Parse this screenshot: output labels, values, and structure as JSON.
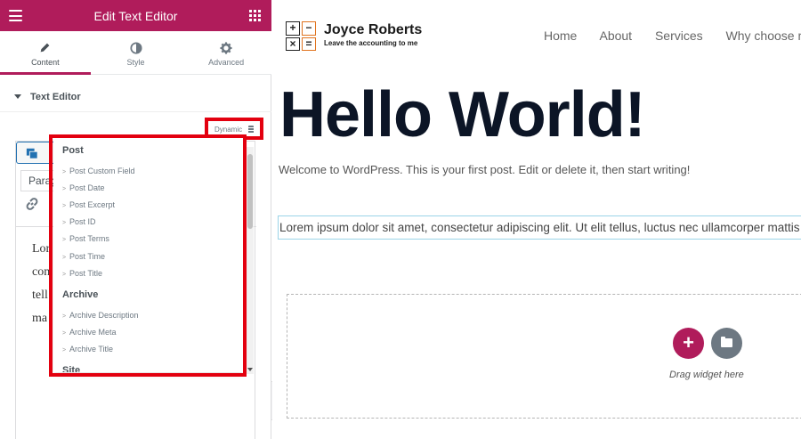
{
  "panel": {
    "title": "Edit Text Editor",
    "tabs": [
      {
        "label": "Content",
        "icon": "pencil-icon",
        "active": true
      },
      {
        "label": "Style",
        "icon": "half-circle-icon",
        "active": false
      },
      {
        "label": "Advanced",
        "icon": "gear-icon",
        "active": false
      }
    ],
    "section_title": "Text Editor",
    "dynamic_label": "Dynamic",
    "paragraph_select": "Paragraph",
    "editor_text_lines": [
      "Lor",
      "con",
      "tell",
      "ma"
    ]
  },
  "dropdown": {
    "groups": [
      {
        "label": "Post",
        "items": [
          "Post Custom Field",
          "Post Date",
          "Post Excerpt",
          "Post ID",
          "Post Terms",
          "Post Time",
          "Post Title"
        ]
      },
      {
        "label": "Archive",
        "items": [
          "Archive Description",
          "Archive Meta",
          "Archive Title"
        ]
      },
      {
        "label": "Site",
        "items": []
      }
    ],
    "bullet": ">"
  },
  "preview": {
    "logo_symbols": [
      "+",
      "−",
      "×",
      "="
    ],
    "brand_name": "Joyce Roberts",
    "brand_tagline": "Leave the accounting to me",
    "nav": [
      "Home",
      "About",
      "Services",
      "Why choose me"
    ],
    "heading": "Hello World!",
    "welcome": "Welcome to WordPress. This is your first post. Edit or delete it, then start writing!",
    "lorem": "Lorem ipsum dolor sit amet, consectetur adipiscing elit. Ut elit tellus, luctus nec ullamcorper mattis",
    "add_symbol": "+",
    "drag_text": "Drag widget here"
  },
  "colors": {
    "brand": "#b01c5b",
    "highlight_red": "#e3000f",
    "heading": "#0c1526",
    "logo_accent": "#e0731f"
  }
}
